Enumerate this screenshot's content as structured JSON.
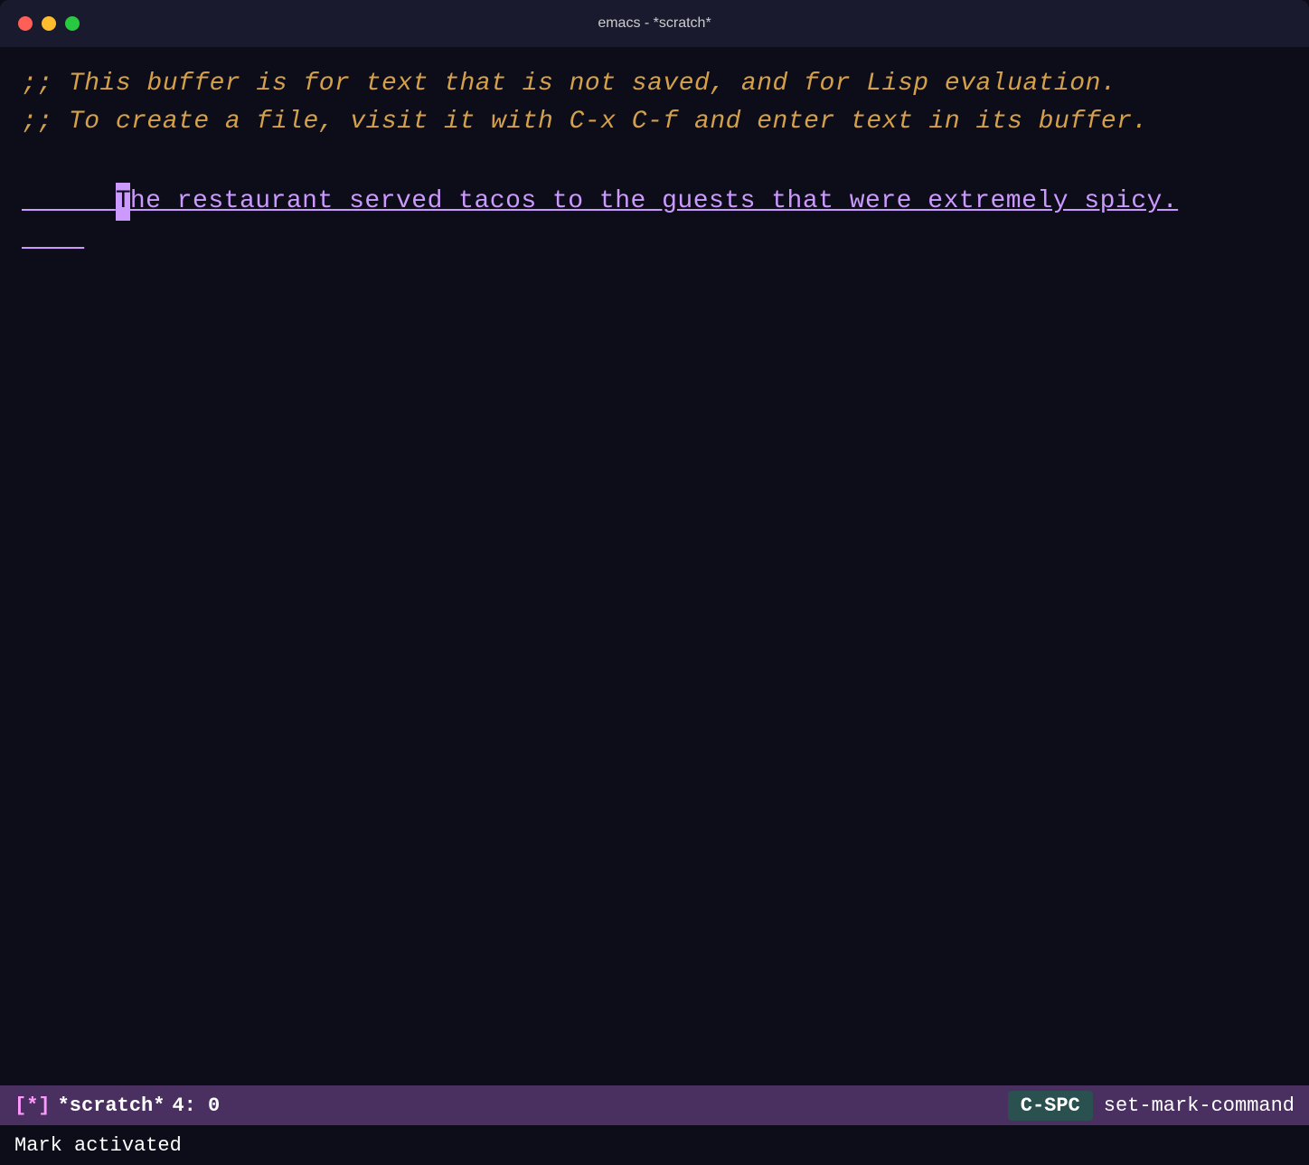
{
  "titlebar": {
    "title": "emacs - *scratch*"
  },
  "traffic_lights": {
    "close_label": "close",
    "minimize_label": "minimize",
    "maximize_label": "maximize"
  },
  "editor": {
    "comment_line1": ";; This buffer is for text that is not saved, and for Lisp evaluation.",
    "comment_line2": ";; To create a file, visit it with C-x C-f and enter text in its buffer.",
    "cursor_char": "T",
    "content_line_after_cursor": "he restaurant served tacos to the guests that were extremely spicy."
  },
  "modeline": {
    "indicator": "[*]",
    "buffer_name": "*scratch*",
    "position": "4: 0",
    "keybinding": "C-SPC",
    "command": "set-mark-command"
  },
  "echo_area": {
    "message": "Mark activated"
  }
}
